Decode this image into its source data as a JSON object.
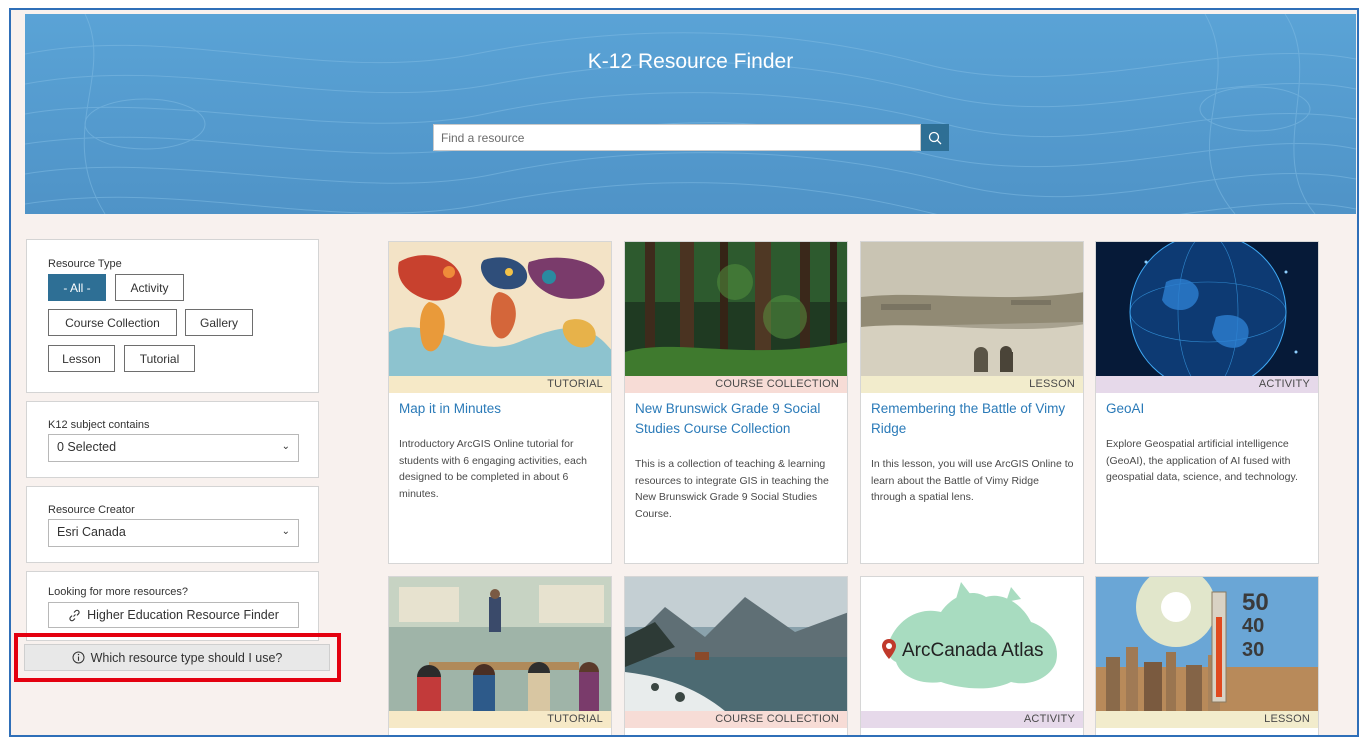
{
  "hero": {
    "title": "K-12 Resource Finder",
    "search_placeholder": "Find a resource",
    "search_icon": "search-icon"
  },
  "filters": {
    "resource_type": {
      "label": "Resource Type",
      "options": [
        "- All -",
        "Activity",
        "Course Collection",
        "Gallery",
        "Lesson",
        "Tutorial"
      ],
      "selected": "- All -"
    },
    "subject": {
      "label": "K12 subject contains",
      "value": "0 Selected",
      "icon": "chevron-down-icon"
    },
    "creator": {
      "label": "Resource Creator",
      "value": "Esri Canada",
      "icon": "chevron-down-icon"
    },
    "more": {
      "label": "Looking for more resources?",
      "link_label": "Higher Education Resource Finder",
      "link_icon": "link-icon"
    },
    "help": {
      "label": "Which resource type should I use?",
      "icon": "info-icon"
    }
  },
  "cards": [
    {
      "type": "TUTORIAL",
      "title": "Map it in Minutes",
      "description": "Introductory ArcGIS Online tutorial for students with 6 engaging activities, each designed to be completed in about 6 minutes.",
      "thumb": "world-map"
    },
    {
      "type": "COURSE COLLECTION",
      "title": "New Brunswick Grade 9 Social Studies Course Collection",
      "description": "This is a collection of teaching & learning resources to integrate GIS in teaching the New Brunswick Grade 9 Social Studies Course.",
      "thumb": "forest"
    },
    {
      "type": "LESSON",
      "title": "Remembering the Battle of Vimy Ridge",
      "description": "In this lesson, you will use ArcGIS Online to learn about the Battle of Vimy Ridge through a spatial lens.",
      "thumb": "battlefield-photo"
    },
    {
      "type": "ACTIVITY",
      "title": "GeoAI",
      "description": "Explore Geospatial artificial intelligence (GeoAI), the application of AI fused with geospatial data, science, and technology.",
      "thumb": "digital-globe"
    },
    {
      "type": "TUTORIAL",
      "title": "",
      "description": "",
      "thumb": "classroom"
    },
    {
      "type": "COURSE COLLECTION",
      "title": "",
      "description": "",
      "thumb": "mountain-lake"
    },
    {
      "type": "ACTIVITY",
      "title": "",
      "description": "",
      "thumb": "canada-map",
      "thumb_text": "ArcCanada Atlas"
    },
    {
      "type": "LESSON",
      "title": "",
      "description": "",
      "thumb": "thermometer-city",
      "thumb_numbers": [
        "50",
        "40",
        "30"
      ]
    }
  ],
  "colors": {
    "accent": "#2e6f95",
    "hero_blue": "#5aa3d6",
    "link_blue": "#2a7ab8",
    "highlight_red": "#e4000f",
    "tutorial_bar": "#f6e9c7",
    "course_bar": "#f7dcd6",
    "lesson_bar": "#f2eccc",
    "activity_bar": "#e6d9ea"
  }
}
